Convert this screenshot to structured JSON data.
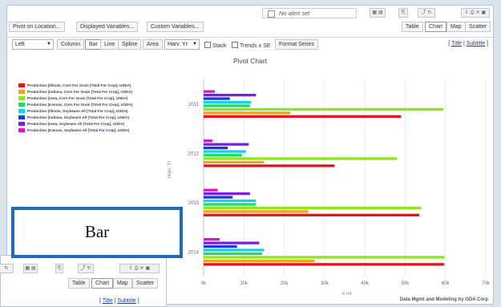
{
  "toolbar": {
    "pivot_location": "Pivot on Location...",
    "displayed_variables": "Displayed Variables...",
    "custom_variables": "Custom Variables...",
    "alert_text": "No alert set",
    "icons": [
      "table-icon",
      "grid-icon",
      "copy-icon",
      "link-icon",
      "refresh-icon",
      "export-icon",
      "print-icon",
      "excel-icon",
      "pdf-icon"
    ]
  },
  "view_tabs": [
    "Table",
    "Chart",
    "Map",
    "Scatter"
  ],
  "active_view": "Chart",
  "chart_controls": {
    "axis_select": "Left",
    "types": [
      "Column",
      "Bar",
      "Line",
      "Spline",
      "Area"
    ],
    "active_type": "Bar",
    "series_select": "Harv. Yr",
    "stack_label": "Stack",
    "trends_label": "Trends ± SE",
    "format_series": "Format Series",
    "title_link": "Title",
    "subtitle_link": "Subtitle"
  },
  "chart_data": {
    "type": "bar",
    "title": "Pivot Chart",
    "ylabel": "Harv. Yr",
    "xlabel": "k-mt",
    "categories": [
      "2011",
      "2012",
      "2013",
      "2014"
    ],
    "xlim": [
      0,
      70
    ],
    "xticks": [
      "0k",
      "10k",
      "20k",
      "30k",
      "40k",
      "50k",
      "60k",
      "70k"
    ],
    "series": [
      {
        "name": "Production (Illinois, Corn For Grain [Total For Crop], USDA)",
        "color": "#e8141c",
        "values": [
          49,
          32.5,
          53.5,
          59.7
        ]
      },
      {
        "name": "Production (Indiana, Corn For Grain [Total For Crop], USDA)",
        "color": "#f5a21b",
        "values": [
          21.5,
          15,
          26,
          27.5
        ]
      },
      {
        "name": "Production (Iowa, Corn For Grain [Total For Crop], USDA)",
        "color": "#8ee61c",
        "values": [
          59.5,
          48,
          54,
          59.8
        ]
      },
      {
        "name": "Production (Kansas, Corn For Grain [Total For Crop], USDA)",
        "color": "#1fdc6a",
        "values": [
          11.5,
          9.5,
          13,
          14.5
        ]
      },
      {
        "name": "Production (Illinois, Soybeans All [Total For Crop], USDA)",
        "color": "#14d2e6",
        "values": [
          11.8,
          10.5,
          13,
          15
        ]
      },
      {
        "name": "Production (Indiana, Soybeans All [Total For Crop], USDA)",
        "color": "#1a3adc",
        "values": [
          6.5,
          6,
          7.2,
          8.3
        ]
      },
      {
        "name": "Production (Iowa, Soybeans All [Total For Crop], USDA)",
        "color": "#7a1ee0",
        "values": [
          13,
          11.2,
          11.5,
          13.8
        ]
      },
      {
        "name": "Production (Kansas, Soybeans All [Total For Crop], USDA)",
        "color": "#e214c4",
        "values": [
          2.8,
          2.2,
          3.5,
          4
        ]
      }
    ],
    "credit": "Data Mgmt and Modeling by GDA Corp"
  },
  "overlay": {
    "view_tabs": [
      "Table",
      "Chart",
      "Map",
      "Scatter"
    ],
    "title_link": "Title",
    "subtitle_link": "Subtitle"
  },
  "callout": {
    "label": "Bar"
  }
}
